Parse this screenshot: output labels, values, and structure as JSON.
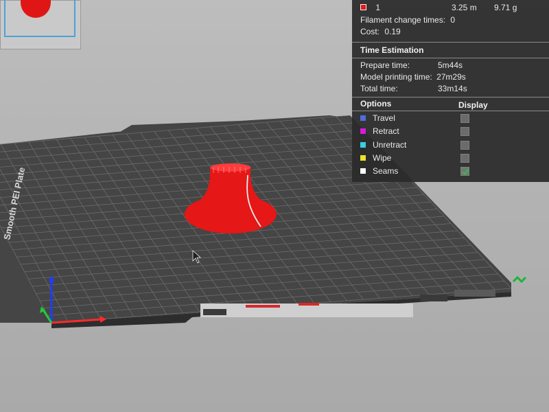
{
  "colors": {
    "model": "#e51717",
    "panel_bg": "#2a2a2a",
    "travel": "#4f6de0",
    "retract": "#d51cd6",
    "unretract": "#37d1dc",
    "wipe": "#f0e12a",
    "seams": "#ffffff",
    "check": "#29c54b"
  },
  "plate": {
    "label": "Smooth PEI Plate"
  },
  "summary": {
    "extruder_id": "1",
    "length": "3.25 m",
    "weight": "9.71 g",
    "filament_change_label": "Filament change times:",
    "filament_change_value": "0",
    "cost_label": "Cost:",
    "cost_value": "0.19"
  },
  "time_estimation": {
    "title": "Time Estimation",
    "prepare_label": "Prepare time:",
    "prepare_value": "5m44s",
    "model_label": "Model printing time:",
    "model_value": "27m29s",
    "total_label": "Total time:",
    "total_value": "33m14s"
  },
  "options": {
    "header_options": "Options",
    "header_display": "Display",
    "items": [
      {
        "label": "Travel",
        "checked": false
      },
      {
        "label": "Retract",
        "checked": false
      },
      {
        "label": "Unretract",
        "checked": false
      },
      {
        "label": "Wipe",
        "checked": false
      },
      {
        "label": "Seams",
        "checked": true
      }
    ]
  }
}
